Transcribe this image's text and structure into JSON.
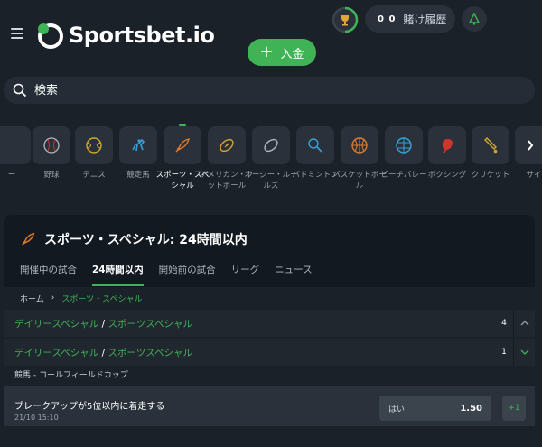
{
  "header": {
    "logo_text": "Sportsbet.io",
    "bet_history_count": "0 0",
    "bet_history_label": "賭け履歴",
    "deposit_label": "入金"
  },
  "search": {
    "placeholder": "検索"
  },
  "sports": [
    {
      "label": "ー",
      "icon": "sport-icon"
    },
    {
      "label": "野球",
      "icon": "baseball-icon"
    },
    {
      "label": "テニス",
      "icon": "tennis-icon"
    },
    {
      "label": "競走馬",
      "icon": "horse-racing-icon"
    },
    {
      "label": "スポーツ・スペシャル",
      "icon": "rocket-icon",
      "active": true
    },
    {
      "label": "アメリカン・フットボール",
      "icon": "american-football-icon"
    },
    {
      "label": "オージー・ルールズ",
      "icon": "aussie-rules-icon"
    },
    {
      "label": "バドミントン",
      "icon": "badminton-icon"
    },
    {
      "label": "バスケットボール",
      "icon": "basketball-icon"
    },
    {
      "label": "ビーチバレー",
      "icon": "beach-volleyball-icon"
    },
    {
      "label": "ボクシング",
      "icon": "boxing-icon"
    },
    {
      "label": "クリケット",
      "icon": "cricket-icon"
    },
    {
      "label": "サイ",
      "icon": "cycling-icon"
    }
  ],
  "panel": {
    "title": "スポーツ・スペシャル: 24時間以内",
    "tabs": [
      {
        "label": "開催中の試合"
      },
      {
        "label": "24時間以内",
        "active": true
      },
      {
        "label": "開始前の試合"
      },
      {
        "label": "リーグ"
      },
      {
        "label": "ニュース"
      }
    ]
  },
  "breadcrumb": {
    "home": "ホーム",
    "current": "スポーツ・スペシャル"
  },
  "categories": [
    {
      "part1": "デイリースペシャル",
      "slash": "/",
      "part2": "スポーツスペシャル",
      "count": "4",
      "expanded": true
    },
    {
      "part1": "デイリースペシャル",
      "slash": "/",
      "part2": "スポーツスペシャル",
      "count": "1",
      "expanded": false
    }
  ],
  "event_group": "競馬 - コールフィールドカップ",
  "market": {
    "name": "ブレークアップが5位以内に着走する",
    "date": "21/10 15:10",
    "odds_label": "はい",
    "odds_value": "1.50",
    "more_label": "+1"
  },
  "colors": {
    "accent": "#3fb356",
    "background": "#1b2129",
    "panel": "#131920",
    "row": "#20272f"
  }
}
